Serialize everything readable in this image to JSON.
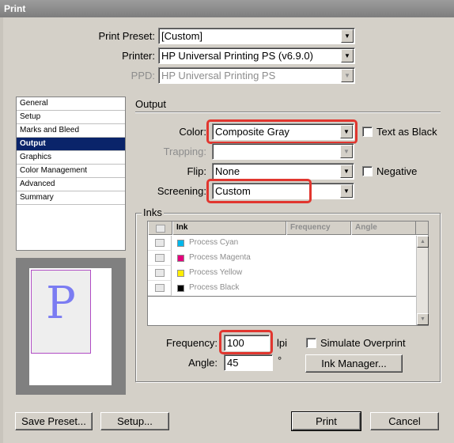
{
  "window": {
    "title": "Print"
  },
  "preset": {
    "label": "Print Preset:",
    "value": "[Custom]"
  },
  "printer": {
    "label": "Printer:",
    "value": "HP Universal Printing PS (v6.9.0)"
  },
  "ppd": {
    "label": "PPD:",
    "value": "HP Universal Printing PS"
  },
  "sidebar": {
    "items": [
      {
        "label": "General"
      },
      {
        "label": "Setup"
      },
      {
        "label": "Marks and Bleed"
      },
      {
        "label": "Output"
      },
      {
        "label": "Graphics"
      },
      {
        "label": "Color Management"
      },
      {
        "label": "Advanced"
      },
      {
        "label": "Summary"
      }
    ],
    "selected": "Output"
  },
  "preview": {
    "letter": "P"
  },
  "output": {
    "section_title": "Output",
    "color_label": "Color:",
    "color_value": "Composite Gray",
    "text_as_black_label": "Text as Black",
    "trapping_label": "Trapping:",
    "trapping_value": "",
    "flip_label": "Flip:",
    "flip_value": "None",
    "negative_label": "Negative",
    "screening_label": "Screening:",
    "screening_value": "Custom"
  },
  "inks": {
    "group_title": "Inks",
    "columns": [
      "Ink",
      "Frequency",
      "Angle"
    ],
    "rows": [
      {
        "name": "Process Cyan",
        "color": "#00b7eb"
      },
      {
        "name": "Process Magenta",
        "color": "#e4007c"
      },
      {
        "name": "Process Yellow",
        "color": "#ffee00"
      },
      {
        "name": "Process Black",
        "color": "#000000"
      }
    ],
    "frequency_label": "Frequency:",
    "frequency_value": "100",
    "frequency_unit": "lpi",
    "simulate_overprint_label": "Simulate Overprint",
    "angle_label": "Angle:",
    "angle_value": "45",
    "angle_unit": "°",
    "ink_manager_label": "Ink Manager..."
  },
  "buttons": {
    "save_preset": "Save Preset...",
    "setup": "Setup...",
    "print": "Print",
    "cancel": "Cancel"
  },
  "highlight_color": "#e1362f"
}
